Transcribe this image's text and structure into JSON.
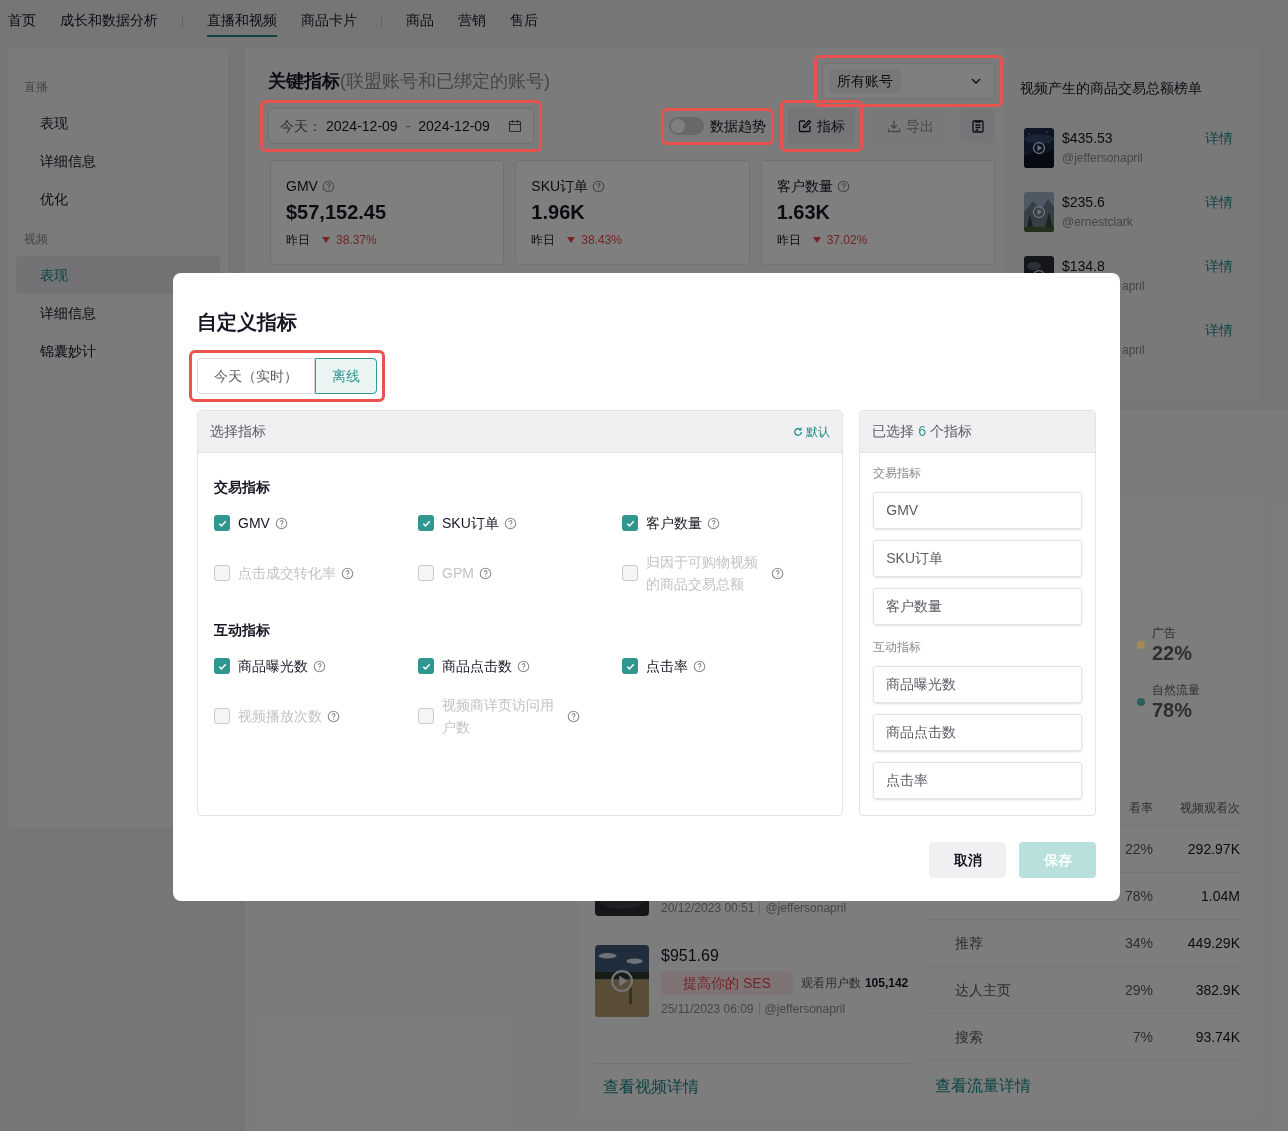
{
  "top_nav": [
    [
      {
        "label": "首页",
        "selected": false
      },
      {
        "label": "成长和数据分析",
        "selected": false
      }
    ],
    [
      {
        "label": "直播和视频",
        "selected": true
      },
      {
        "label": "商品卡片",
        "selected": false
      }
    ],
    [
      {
        "label": "商品",
        "selected": false
      },
      {
        "label": "营销",
        "selected": false
      },
      {
        "label": "售后",
        "selected": false
      }
    ]
  ],
  "sidebar": {
    "sections": [
      {
        "title": "直播",
        "items": [
          {
            "label": "表现",
            "selected": false
          },
          {
            "label": "详细信息",
            "selected": false
          },
          {
            "label": "优化",
            "selected": false
          }
        ]
      },
      {
        "title": "视频",
        "items": [
          {
            "label": "表现",
            "selected": true
          },
          {
            "label": "详细信息",
            "selected": false
          },
          {
            "label": "锦囊妙计",
            "selected": false
          }
        ]
      }
    ]
  },
  "key_metrics": {
    "title": "关键指标",
    "subtitle": "(联盟账号和已绑定的账号)",
    "account_select": {
      "value": "所有账号",
      "highlighted": true
    },
    "date_range": {
      "prefix": "今天：",
      "start": "2024-12-09",
      "separator": "-",
      "end": "2024-12-09",
      "highlighted": true
    },
    "trend_toggle": {
      "label": "数据趋势",
      "on": false,
      "highlighted": true
    },
    "metrics_button": {
      "label": "指标",
      "highlighted": true
    },
    "export_button": {
      "label": "导出",
      "disabled": true
    },
    "cards": [
      {
        "label": "GMV",
        "value": "$57,152.45",
        "compare_label": "昨日",
        "change": "38.37%"
      },
      {
        "label": "SKU订单",
        "value": "1.96K",
        "compare_label": "昨日",
        "change": "38.43%"
      },
      {
        "label": "客户数量",
        "value": "1.63K",
        "compare_label": "昨日",
        "change": "37.02%"
      }
    ]
  },
  "ranking": {
    "title": "视频产生的商品交易总额榜单",
    "items": [
      {
        "kind": "full",
        "amount": "$435.53",
        "handle": "@jeffersonapril",
        "link": "详情"
      },
      {
        "kind": "full",
        "amount": "$235.6",
        "handle": "@ernestclark",
        "link": "详情"
      },
      {
        "kind": "partial",
        "amount": "$134.8",
        "handle": "april",
        "link": "详情"
      },
      {
        "kind": "covered",
        "handle": "april",
        "link": "详情"
      }
    ]
  },
  "videos": {
    "items": [
      {
        "kind": "covered",
        "date": "20/12/2023 00:51",
        "handle": "@jeffersonapril"
      },
      {
        "kind": "full",
        "amount": "$951.69",
        "badge": "提高你的 SES",
        "viewers_label": "观看用户数",
        "viewers": "105,142",
        "date": "25/11/2023 06:09",
        "handle": "@jeffersonapril"
      }
    ],
    "link": "查看视频详情"
  },
  "traffic": {
    "legend": [
      {
        "label": "广告",
        "value": "22%",
        "color": "#a88a55"
      },
      {
        "label": "自然流量",
        "value": "78%",
        "color": "#2d5e5b"
      }
    ],
    "columns": [
      "看率",
      "视频观看次"
    ],
    "rows": [
      {
        "share": "22%",
        "views": "292.97K"
      },
      {
        "share": "78%",
        "views": "1.04M"
      },
      {
        "label": "推荐",
        "share": "34%",
        "views": "449.29K"
      },
      {
        "label": "达人主页",
        "share": "29%",
        "views": "382.9K"
      },
      {
        "label": "搜索",
        "share": "7%",
        "views": "93.74K"
      }
    ],
    "link": "查看流量详情"
  },
  "modal": {
    "title": "自定义指标",
    "mode_switch": {
      "highlighted": true,
      "options": [
        {
          "label": "今天（实时）",
          "selected": false
        },
        {
          "label": "离线",
          "selected": true
        }
      ]
    },
    "picker": {
      "title": "选择指标",
      "reset": "默认",
      "sections": [
        {
          "title": "交易指标",
          "items": [
            {
              "label": "GMV",
              "checked": true,
              "disabled": false
            },
            {
              "label": "SKU订单",
              "checked": true,
              "disabled": false
            },
            {
              "label": "客户数量",
              "checked": true,
              "disabled": false
            },
            {
              "label": "点击成交转化率",
              "checked": false,
              "disabled": true
            },
            {
              "label": "GPM",
              "checked": false,
              "disabled": true
            },
            {
              "label": "归因于可购物视频的商品交易总额",
              "checked": false,
              "disabled": true
            }
          ]
        },
        {
          "title": "互动指标",
          "items": [
            {
              "label": "商品曝光数",
              "checked": true,
              "disabled": false
            },
            {
              "label": "商品点击数",
              "checked": true,
              "disabled": false
            },
            {
              "label": "点击率",
              "checked": true,
              "disabled": false
            },
            {
              "label": "视频播放次数",
              "checked": false,
              "disabled": true
            },
            {
              "label": "视频商详页访问用户数",
              "checked": false,
              "disabled": true
            }
          ]
        }
      ]
    },
    "selected_panel": {
      "prefix": "已选择",
      "count": "6",
      "suffix": "个指标",
      "groups": [
        {
          "title": "交易指标",
          "items": [
            "GMV",
            "SKU订单",
            "客户数量"
          ]
        },
        {
          "title": "互动指标",
          "items": [
            "商品曝光数",
            "商品点击数",
            "点击率"
          ]
        }
      ]
    },
    "buttons": [
      {
        "label": "取消",
        "kind": "secondary",
        "disabled": false
      },
      {
        "label": "保存",
        "kind": "primary",
        "disabled": true
      }
    ]
  }
}
